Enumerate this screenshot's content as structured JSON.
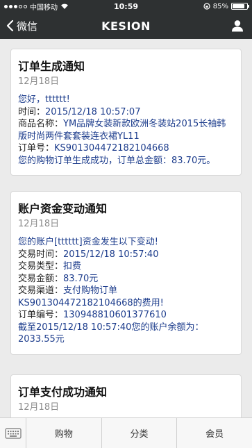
{
  "status_bar": {
    "carrier": "中国移动",
    "time": "10:59",
    "battery_percent": "85%",
    "battery_level": 0.85
  },
  "nav": {
    "back_label": "微信",
    "title": "KESION"
  },
  "cards": [
    {
      "title": "订单生成通知",
      "date": "12月18日",
      "greeting": "您好，tttttt!",
      "time_label": "时间：",
      "time_value": "2015/12/18 10:57:07",
      "product_label": "商品名称：",
      "product_value_1": "YM品牌女装新款欧洲冬装站2015长袖韩",
      "product_value_2": "版时尚两件套套装连衣裙YL11",
      "order_label": "订单号：",
      "order_value": "KS901304472182104668",
      "summary": "您的购物订单生成成功，订单总金额：83.70元。"
    },
    {
      "title": "账户资金变动通知",
      "date": "12月18日",
      "intro": "您的账户[tttttt]资金发生以下变动!",
      "tx_time_label": "交易时间：",
      "tx_time_value": "2015/12/18 10:57:40",
      "tx_type_label": "交易类型：",
      "tx_type_value": "扣费",
      "tx_amount_label": "交易金额：",
      "tx_amount_value": "83.70元",
      "tx_channel_label": "交易渠道：",
      "tx_channel_value_1": "支付购物订单",
      "tx_channel_value_2": "KS901304472182104668的费用!",
      "order_no_label": "订单编号：",
      "order_no_value": "130948810601377610",
      "balance_1": "截至2015/12/18 10:57:40您的账户余额为：",
      "balance_2": "2033.55元"
    },
    {
      "title": "订单支付成功通知",
      "date": "12月18日"
    }
  ],
  "tabbar": {
    "items": [
      "购物",
      "分类",
      "会员"
    ]
  }
}
